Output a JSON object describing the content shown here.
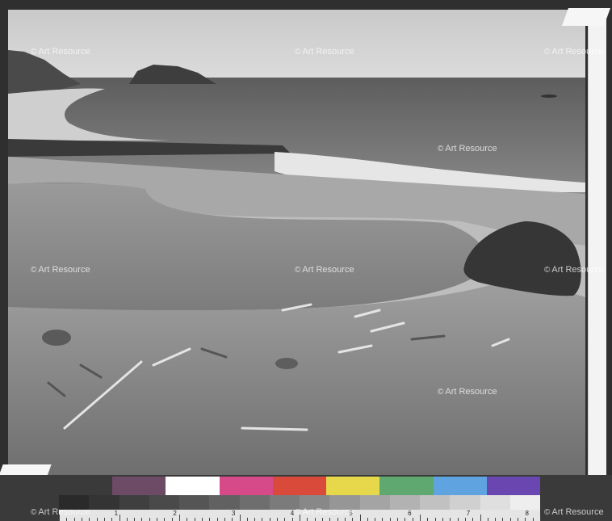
{
  "image": {
    "watermark_text": "Art Resource",
    "scene": "Black and white coastal landscape photograph: a beach and lagoon in foreground with driftwood, a large boulder on the right, surf and sea stacks on the horizon.",
    "colors": {
      "frame": "#2f2f2f",
      "mount": "#f3f3f3",
      "sky": "#d4d4d4",
      "sea": "#7a7a7a",
      "lagoon": "#8c8c8c",
      "sand": "#b2b2b2"
    },
    "color_chart": [
      "#3a3a3a",
      "#6d4a65",
      "#ffffff",
      "#d64a8a",
      "#d94a3a",
      "#e6d84a",
      "#5fa870",
      "#5fa4e0",
      "#6a46b0"
    ],
    "gray_scale": [
      "#2a2a2a",
      "#343434",
      "#3f3f3f",
      "#4a4a4a",
      "#555555",
      "#616161",
      "#6e6e6e",
      "#7b7b7b",
      "#888888",
      "#969696",
      "#a4a4a4",
      "#b2b2b2",
      "#c1c1c1",
      "#d0d0d0",
      "#dfdfdf",
      "#eeeeee"
    ],
    "ruler_numbers": [
      "1",
      "2",
      "3",
      "4",
      "5",
      "6",
      "7",
      "8"
    ]
  }
}
